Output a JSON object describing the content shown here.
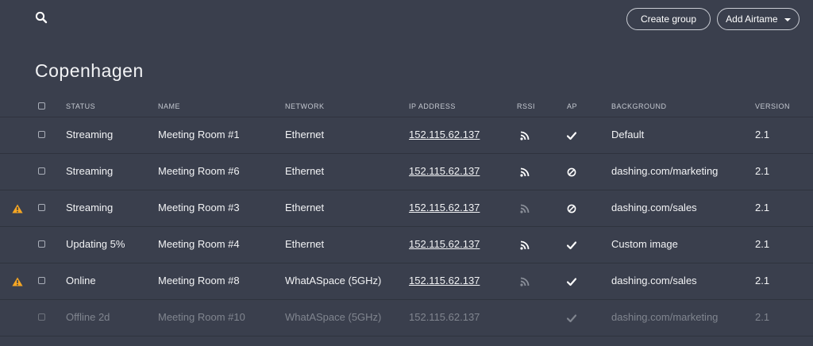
{
  "toolbar": {
    "search_icon": "search-icon",
    "create_group_label": "Create group",
    "add_airtame_label": "Add Airtame",
    "add_airtame_icon": "chevron-down-icon"
  },
  "page": {
    "title": "Copenhagen"
  },
  "table": {
    "columns": [
      "STATUS",
      "NAME",
      "NETWORK",
      "IP ADDRESS",
      "RSSI",
      "AP",
      "BACKGROUND",
      "VERSION"
    ],
    "rows": [
      {
        "warning": false,
        "status": "Streaming",
        "name": "Meeting Room #1",
        "network": "Ethernet",
        "ip": "152.115.62.137",
        "rssi": "strong",
        "ap": "enabled",
        "background": "Default",
        "version": "2.1",
        "offline": false
      },
      {
        "warning": false,
        "status": "Streaming",
        "name": "Meeting Room #6",
        "network": "Ethernet",
        "ip": "152.115.62.137",
        "rssi": "strong",
        "ap": "disabled",
        "background": "dashing.com/marketing",
        "version": "2.1",
        "offline": false
      },
      {
        "warning": true,
        "status": "Streaming",
        "name": "Meeting Room #3",
        "network": "Ethernet",
        "ip": "152.115.62.137",
        "rssi": "weak",
        "ap": "disabled",
        "background": "dashing.com/sales",
        "version": "2.1",
        "offline": false
      },
      {
        "warning": false,
        "status": "Updating 5%",
        "name": "Meeting Room #4",
        "network": "Ethernet",
        "ip": "152.115.62.137",
        "rssi": "strong",
        "ap": "enabled",
        "background": "Custom image",
        "version": "2.1",
        "offline": false
      },
      {
        "warning": true,
        "status": "Online",
        "name": "Meeting Room #8",
        "network": "WhatASpace (5GHz)",
        "ip": "152.115.62.137",
        "rssi": "weak",
        "ap": "enabled",
        "background": "dashing.com/sales",
        "version": "2.1",
        "offline": false
      },
      {
        "warning": false,
        "status": "Offline 2d",
        "name": "Meeting Room #10",
        "network": "WhatASpace (5GHz)",
        "ip": "152.115.62.137",
        "rssi": "none",
        "ap": "enabled",
        "background": "dashing.com/marketing",
        "version": "2.1",
        "offline": true
      }
    ]
  },
  "colors": {
    "background": "#3a3f4d",
    "row_divider": "#2f333e",
    "text": "#f2f3f5",
    "muted_text": "#80858f",
    "warning": "#f5a623"
  }
}
